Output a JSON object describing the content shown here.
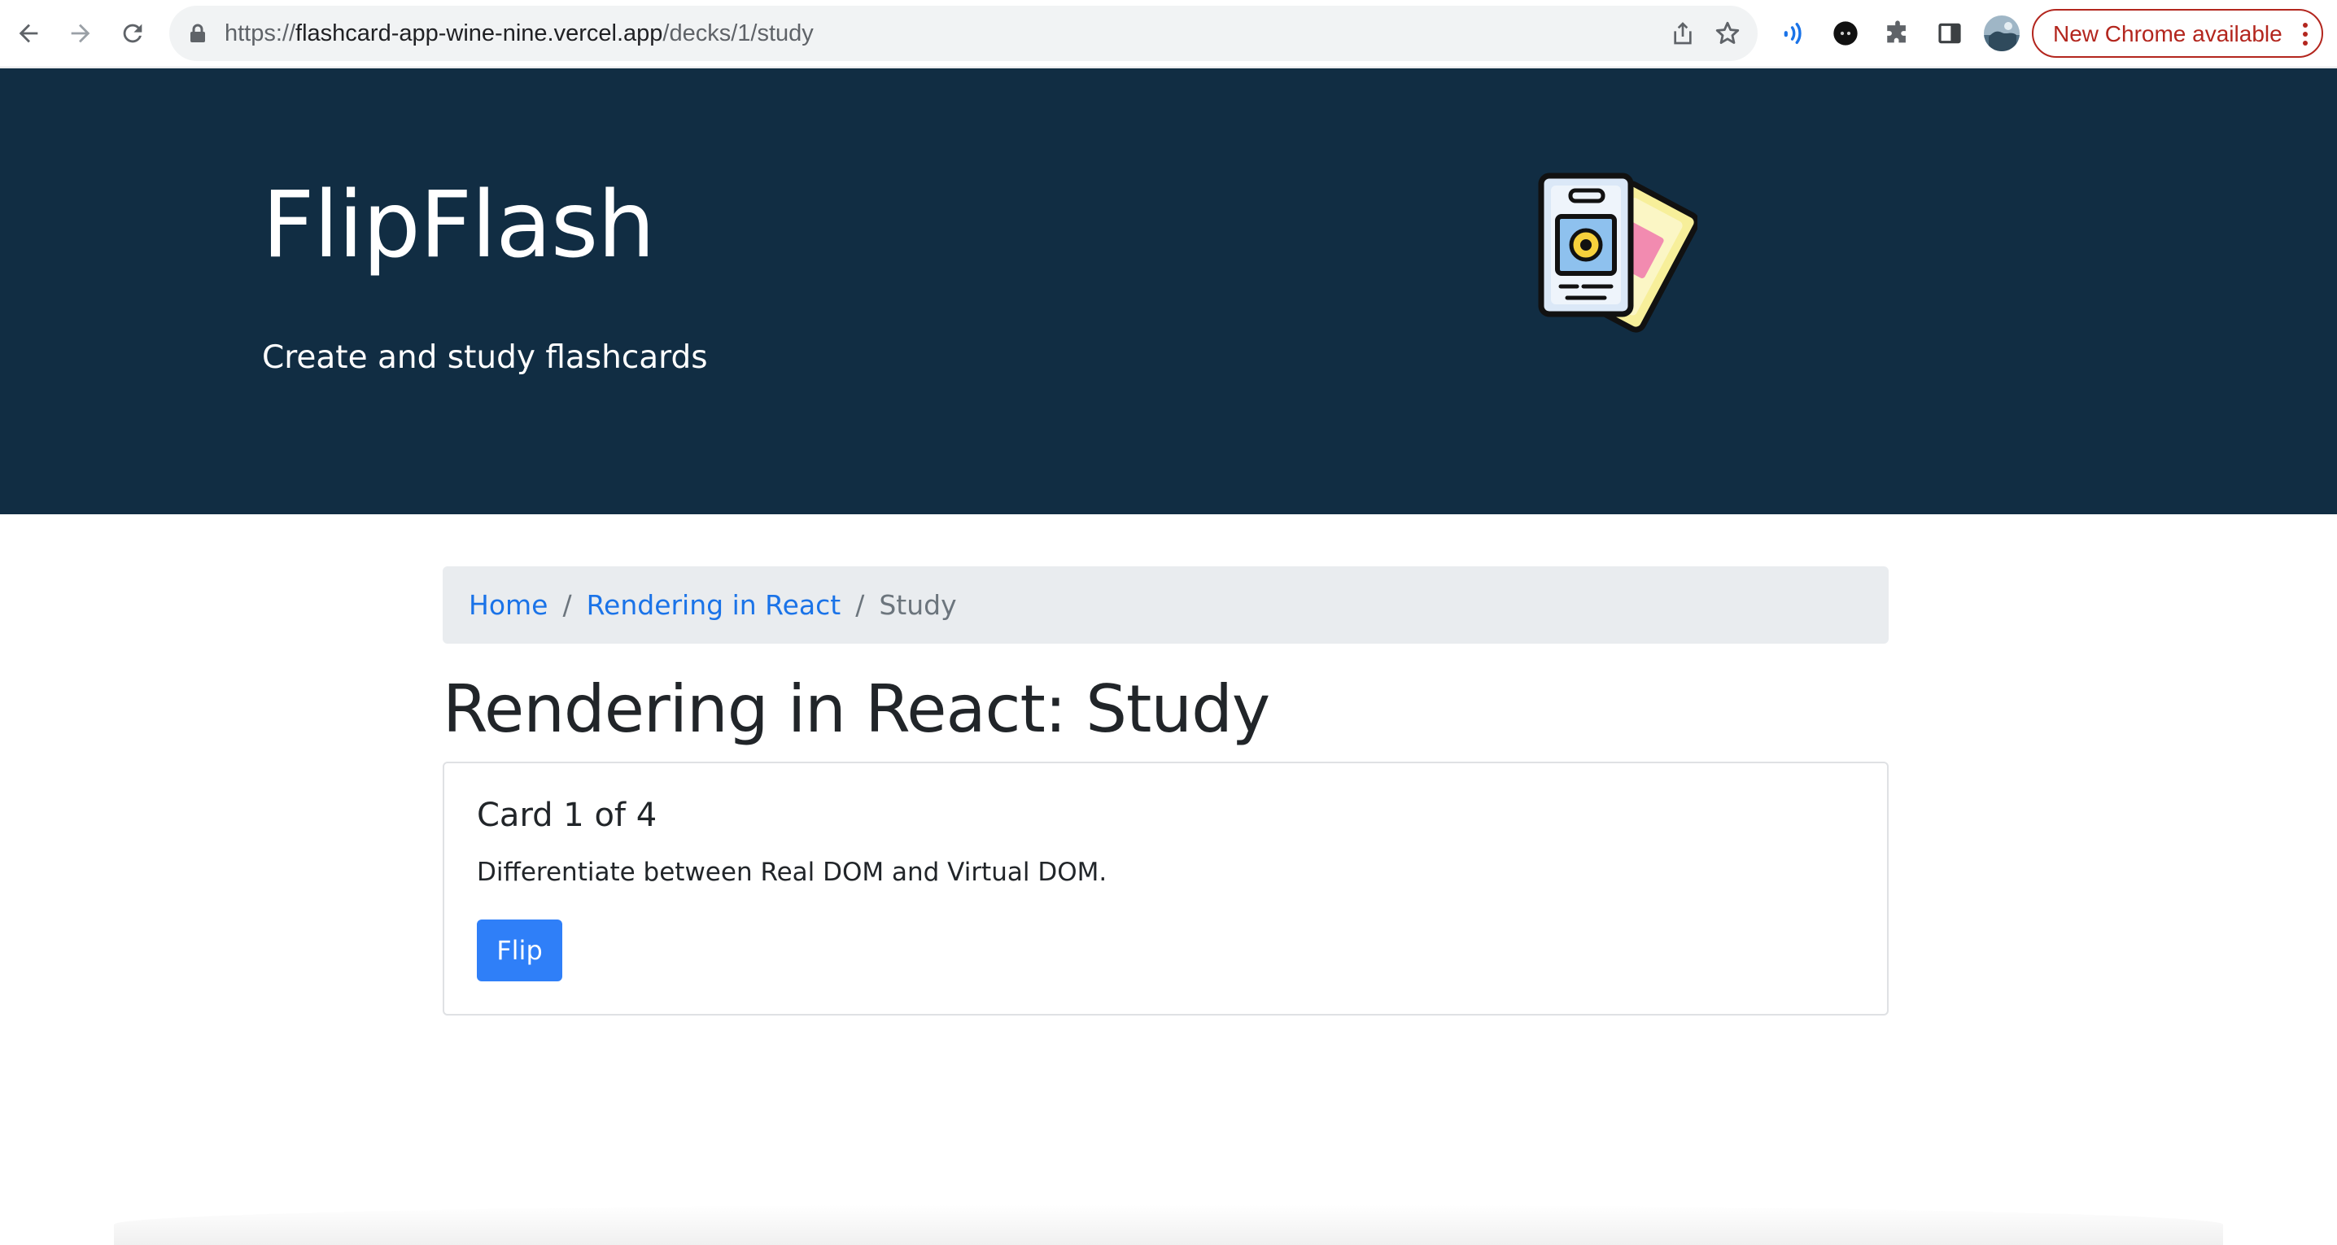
{
  "browser": {
    "url": {
      "scheme": "https://",
      "host": "flashcard-app-wine-nine.vercel.app",
      "path": "/decks/1/study"
    },
    "update_button_label": "New Chrome available",
    "icons": [
      "back-icon",
      "forward-icon",
      "reload-icon",
      "lock-icon",
      "share-icon",
      "bookmark-star-icon",
      "audio-extension-icon",
      "dark-extension-icon",
      "puzzle-icon",
      "side-panel-icon",
      "avatar",
      "more-vert-icon"
    ]
  },
  "header": {
    "title": "FlipFlash",
    "subtitle": "Create and study flashcards",
    "logo_icon": "flashcards-logo-icon",
    "background_color": "#112d43"
  },
  "breadcrumb": {
    "home": "Home",
    "deck": "Rendering in React",
    "current": "Study",
    "separator": "/"
  },
  "page": {
    "title": "Rendering in React: Study"
  },
  "card": {
    "counter": "Card 1 of 4",
    "front": "Differentiate between Real DOM and Virtual DOM.",
    "flip_label": "Flip",
    "accent_color": "#2f7ff8"
  }
}
